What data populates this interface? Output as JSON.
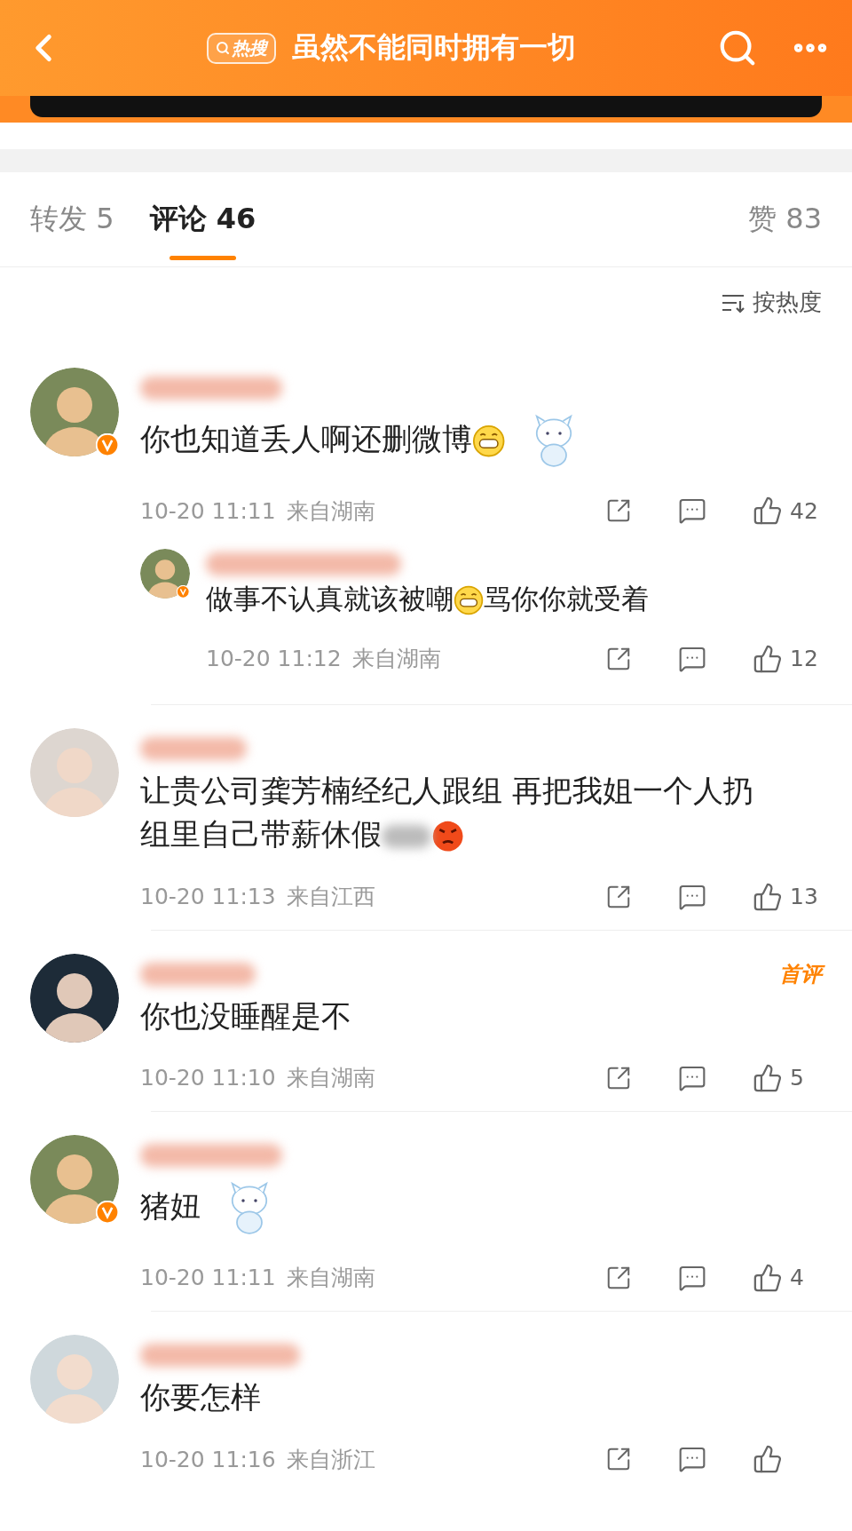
{
  "header": {
    "badge": "热搜",
    "title": "虽然不能同时拥有一切"
  },
  "tabs": [
    {
      "label": "转发",
      "count": "5",
      "selected": false
    },
    {
      "label": "评论",
      "count": "46",
      "selected": true
    }
  ],
  "likes_tab": {
    "label": "赞",
    "count": "83"
  },
  "sort": "按热度",
  "comments": [
    {
      "verified": true,
      "sticker": true,
      "parts": [
        {
          "kind": "text",
          "text": "你也知道丢人啊还删微博"
        },
        {
          "kind": "grin"
        }
      ],
      "time": "10-20 11:11",
      "location": "来自湖南",
      "likes": "42",
      "replies": [
        {
          "verified": true,
          "parts": [
            {
              "kind": "text",
              "text": "做事不认真就该被嘲"
            },
            {
              "kind": "grin"
            },
            {
              "kind": "text",
              "text": "骂你你就受着"
            }
          ],
          "time": "10-20 11:12",
          "location": "来自湖南",
          "likes": "12"
        }
      ]
    },
    {
      "verified": false,
      "sticker": false,
      "parts": [
        {
          "kind": "text",
          "text": "让贵公司龚芳楠经纪人跟组 再把我姐一个人扔组里自己带薪休假"
        },
        {
          "kind": "blur"
        },
        {
          "kind": "angry"
        }
      ],
      "time": "10-20 11:13",
      "location": "来自江西",
      "likes": "13"
    },
    {
      "verified": false,
      "first_label": "首评",
      "sticker": false,
      "parts": [
        {
          "kind": "text",
          "text": "你也没睡醒是不"
        }
      ],
      "time": "10-20 11:10",
      "location": "来自湖南",
      "likes": "5"
    },
    {
      "verified": true,
      "sticker": true,
      "parts": [
        {
          "kind": "text",
          "text": "猪妞"
        }
      ],
      "time": "10-20 11:11",
      "location": "来自湖南",
      "likes": "4"
    },
    {
      "verified": false,
      "sticker": false,
      "parts": [
        {
          "kind": "text",
          "text": "你要怎样"
        }
      ],
      "time": "10-20 11:16",
      "location": "来自浙江"
    }
  ]
}
